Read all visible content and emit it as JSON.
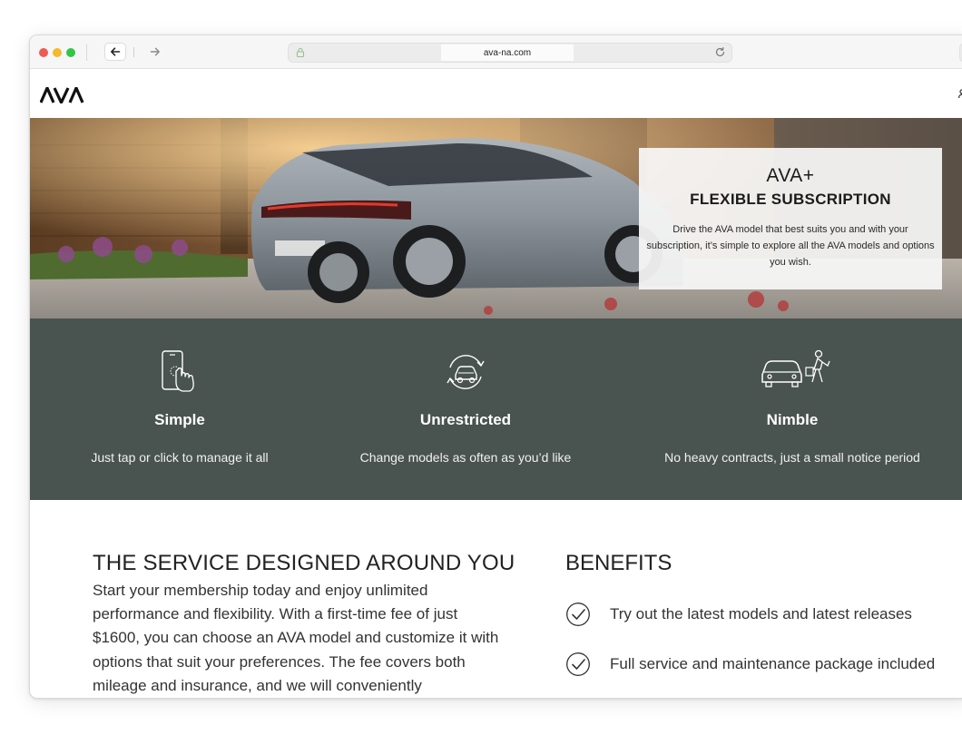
{
  "browser": {
    "url": "ava-na.com"
  },
  "site": {
    "logo_text": "AVA"
  },
  "hero": {
    "title": "AVA+",
    "subtitle": "FLEXIBLE SUBSCRIPTION",
    "description": "Drive the AVA model that best suits you and with your subscription, it’s simple to explore all the AVA models and options you wish."
  },
  "features": [
    {
      "icon": "touch-phone-icon",
      "title": "Simple",
      "description": "Just tap or click to manage it all"
    },
    {
      "icon": "car-swap-icon",
      "title": "Unrestricted",
      "description": "Change models as often as you’d like"
    },
    {
      "icon": "car-person-icon",
      "title": "Nimble",
      "description": "No heavy contracts, just a small notice period"
    }
  ],
  "service": {
    "title": "THE SERVICE DESIGNED AROUND YOU",
    "text": "Start your membership today and enjoy unlimited performance and flexibility. With a first-time fee of just $1600, you can choose an AVA model and customize it with options that suit your preferences. The fee covers both mileage and insurance, and we will conveniently"
  },
  "benefits": {
    "title": "BENEFITS",
    "items": [
      {
        "icon": "check-circle-icon",
        "label": "Try out the latest models and latest releases"
      },
      {
        "icon": "check-circle-icon",
        "label": "Full service and maintenance package included"
      }
    ]
  },
  "colors": {
    "feature_band": "#49534f",
    "traffic_red": "#ee5a53",
    "traffic_yellow": "#f4b92c",
    "traffic_green": "#33c548"
  }
}
